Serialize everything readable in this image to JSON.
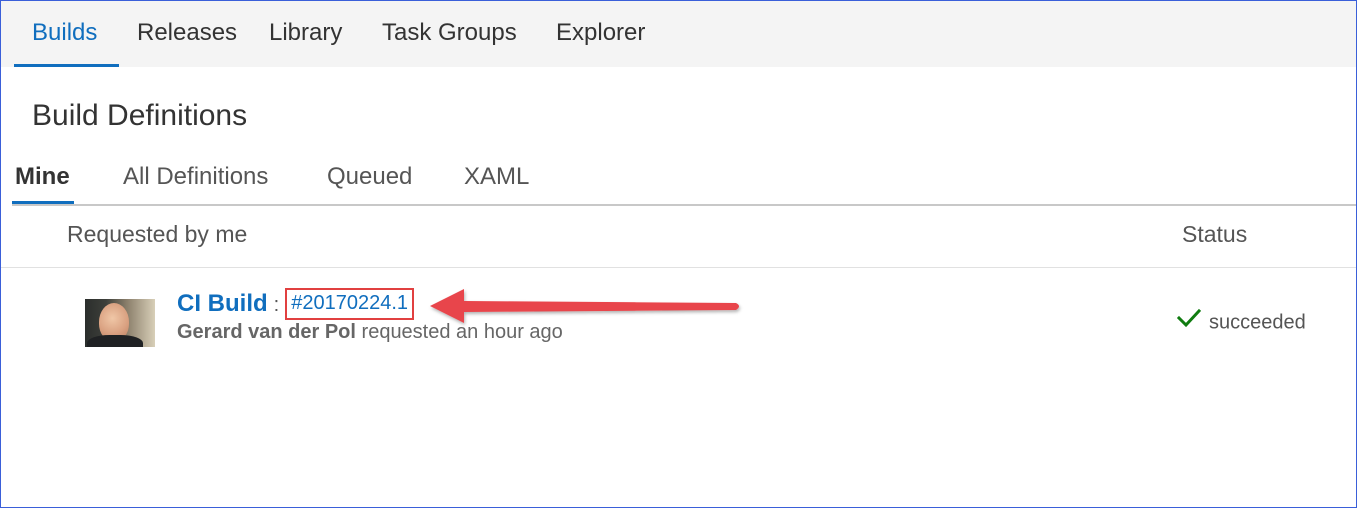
{
  "hub_tabs": [
    {
      "label": "Builds",
      "active": true
    },
    {
      "label": "Releases",
      "active": false
    },
    {
      "label": "Library",
      "active": false
    },
    {
      "label": "Task Groups",
      "active": false
    },
    {
      "label": "Explorer",
      "active": false
    }
  ],
  "page_title": "Build Definitions",
  "pivots": [
    {
      "label": "Mine",
      "active": true
    },
    {
      "label": "All Definitions",
      "active": false
    },
    {
      "label": "Queued",
      "active": false
    },
    {
      "label": "XAML",
      "active": false
    }
  ],
  "columns": {
    "requested": "Requested by me",
    "status": "Status"
  },
  "builds": [
    {
      "definition": "CI Build",
      "separator": ":",
      "number": "#20170224.1",
      "user": "Gerard van der Pol",
      "requested_text": "requested an hour ago",
      "status": "succeeded",
      "status_icon": "check-icon",
      "status_color": "#107c10"
    }
  ],
  "colors": {
    "accent": "#106ebe",
    "highlight_box": "#e14040",
    "arrow": "#e8454b"
  }
}
